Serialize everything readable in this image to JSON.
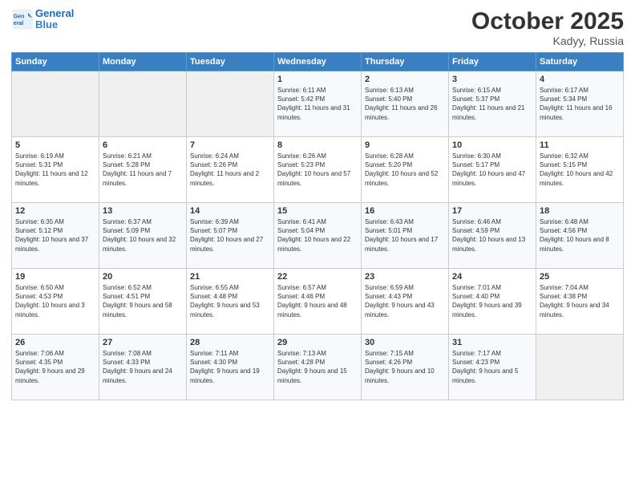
{
  "header": {
    "logo_line1": "General",
    "logo_line2": "Blue",
    "month": "October 2025",
    "location": "Kadyy, Russia"
  },
  "days_of_week": [
    "Sunday",
    "Monday",
    "Tuesday",
    "Wednesday",
    "Thursday",
    "Friday",
    "Saturday"
  ],
  "weeks": [
    [
      {
        "day": "",
        "sunrise": "",
        "sunset": "",
        "daylight": "",
        "empty": true
      },
      {
        "day": "",
        "sunrise": "",
        "sunset": "",
        "daylight": "",
        "empty": true
      },
      {
        "day": "",
        "sunrise": "",
        "sunset": "",
        "daylight": "",
        "empty": true
      },
      {
        "day": "1",
        "sunrise": "Sunrise: 6:11 AM",
        "sunset": "Sunset: 5:42 PM",
        "daylight": "Daylight: 11 hours and 31 minutes."
      },
      {
        "day": "2",
        "sunrise": "Sunrise: 6:13 AM",
        "sunset": "Sunset: 5:40 PM",
        "daylight": "Daylight: 11 hours and 26 minutes."
      },
      {
        "day": "3",
        "sunrise": "Sunrise: 6:15 AM",
        "sunset": "Sunset: 5:37 PM",
        "daylight": "Daylight: 11 hours and 21 minutes."
      },
      {
        "day": "4",
        "sunrise": "Sunrise: 6:17 AM",
        "sunset": "Sunset: 5:34 PM",
        "daylight": "Daylight: 11 hours and 16 minutes."
      }
    ],
    [
      {
        "day": "5",
        "sunrise": "Sunrise: 6:19 AM",
        "sunset": "Sunset: 5:31 PM",
        "daylight": "Daylight: 11 hours and 12 minutes."
      },
      {
        "day": "6",
        "sunrise": "Sunrise: 6:21 AM",
        "sunset": "Sunset: 5:28 PM",
        "daylight": "Daylight: 11 hours and 7 minutes."
      },
      {
        "day": "7",
        "sunrise": "Sunrise: 6:24 AM",
        "sunset": "Sunset: 5:26 PM",
        "daylight": "Daylight: 11 hours and 2 minutes."
      },
      {
        "day": "8",
        "sunrise": "Sunrise: 6:26 AM",
        "sunset": "Sunset: 5:23 PM",
        "daylight": "Daylight: 10 hours and 57 minutes."
      },
      {
        "day": "9",
        "sunrise": "Sunrise: 6:28 AM",
        "sunset": "Sunset: 5:20 PM",
        "daylight": "Daylight: 10 hours and 52 minutes."
      },
      {
        "day": "10",
        "sunrise": "Sunrise: 6:30 AM",
        "sunset": "Sunset: 5:17 PM",
        "daylight": "Daylight: 10 hours and 47 minutes."
      },
      {
        "day": "11",
        "sunrise": "Sunrise: 6:32 AM",
        "sunset": "Sunset: 5:15 PM",
        "daylight": "Daylight: 10 hours and 42 minutes."
      }
    ],
    [
      {
        "day": "12",
        "sunrise": "Sunrise: 6:35 AM",
        "sunset": "Sunset: 5:12 PM",
        "daylight": "Daylight: 10 hours and 37 minutes."
      },
      {
        "day": "13",
        "sunrise": "Sunrise: 6:37 AM",
        "sunset": "Sunset: 5:09 PM",
        "daylight": "Daylight: 10 hours and 32 minutes."
      },
      {
        "day": "14",
        "sunrise": "Sunrise: 6:39 AM",
        "sunset": "Sunset: 5:07 PM",
        "daylight": "Daylight: 10 hours and 27 minutes."
      },
      {
        "day": "15",
        "sunrise": "Sunrise: 6:41 AM",
        "sunset": "Sunset: 5:04 PM",
        "daylight": "Daylight: 10 hours and 22 minutes."
      },
      {
        "day": "16",
        "sunrise": "Sunrise: 6:43 AM",
        "sunset": "Sunset: 5:01 PM",
        "daylight": "Daylight: 10 hours and 17 minutes."
      },
      {
        "day": "17",
        "sunrise": "Sunrise: 6:46 AM",
        "sunset": "Sunset: 4:59 PM",
        "daylight": "Daylight: 10 hours and 13 minutes."
      },
      {
        "day": "18",
        "sunrise": "Sunrise: 6:48 AM",
        "sunset": "Sunset: 4:56 PM",
        "daylight": "Daylight: 10 hours and 8 minutes."
      }
    ],
    [
      {
        "day": "19",
        "sunrise": "Sunrise: 6:50 AM",
        "sunset": "Sunset: 4:53 PM",
        "daylight": "Daylight: 10 hours and 3 minutes."
      },
      {
        "day": "20",
        "sunrise": "Sunrise: 6:52 AM",
        "sunset": "Sunset: 4:51 PM",
        "daylight": "Daylight: 9 hours and 58 minutes."
      },
      {
        "day": "21",
        "sunrise": "Sunrise: 6:55 AM",
        "sunset": "Sunset: 4:48 PM",
        "daylight": "Daylight: 9 hours and 53 minutes."
      },
      {
        "day": "22",
        "sunrise": "Sunrise: 6:57 AM",
        "sunset": "Sunset: 4:46 PM",
        "daylight": "Daylight: 9 hours and 48 minutes."
      },
      {
        "day": "23",
        "sunrise": "Sunrise: 6:59 AM",
        "sunset": "Sunset: 4:43 PM",
        "daylight": "Daylight: 9 hours and 43 minutes."
      },
      {
        "day": "24",
        "sunrise": "Sunrise: 7:01 AM",
        "sunset": "Sunset: 4:40 PM",
        "daylight": "Daylight: 9 hours and 39 minutes."
      },
      {
        "day": "25",
        "sunrise": "Sunrise: 7:04 AM",
        "sunset": "Sunset: 4:38 PM",
        "daylight": "Daylight: 9 hours and 34 minutes."
      }
    ],
    [
      {
        "day": "26",
        "sunrise": "Sunrise: 7:06 AM",
        "sunset": "Sunset: 4:35 PM",
        "daylight": "Daylight: 9 hours and 29 minutes."
      },
      {
        "day": "27",
        "sunrise": "Sunrise: 7:08 AM",
        "sunset": "Sunset: 4:33 PM",
        "daylight": "Daylight: 9 hours and 24 minutes."
      },
      {
        "day": "28",
        "sunrise": "Sunrise: 7:11 AM",
        "sunset": "Sunset: 4:30 PM",
        "daylight": "Daylight: 9 hours and 19 minutes."
      },
      {
        "day": "29",
        "sunrise": "Sunrise: 7:13 AM",
        "sunset": "Sunset: 4:28 PM",
        "daylight": "Daylight: 9 hours and 15 minutes."
      },
      {
        "day": "30",
        "sunrise": "Sunrise: 7:15 AM",
        "sunset": "Sunset: 4:26 PM",
        "daylight": "Daylight: 9 hours and 10 minutes."
      },
      {
        "day": "31",
        "sunrise": "Sunrise: 7:17 AM",
        "sunset": "Sunset: 4:23 PM",
        "daylight": "Daylight: 9 hours and 5 minutes."
      },
      {
        "day": "",
        "sunrise": "",
        "sunset": "",
        "daylight": "",
        "empty": true
      }
    ]
  ]
}
